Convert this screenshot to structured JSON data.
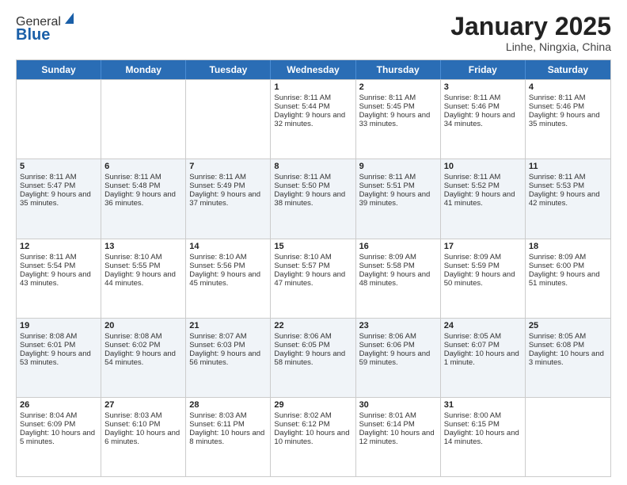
{
  "header": {
    "logo_general": "General",
    "logo_blue": "Blue",
    "month_title": "January 2025",
    "location": "Linhe, Ningxia, China"
  },
  "weekdays": [
    "Sunday",
    "Monday",
    "Tuesday",
    "Wednesday",
    "Thursday",
    "Friday",
    "Saturday"
  ],
  "weeks": [
    [
      {
        "day": "",
        "sunrise": "",
        "sunset": "",
        "daylight": ""
      },
      {
        "day": "",
        "sunrise": "",
        "sunset": "",
        "daylight": ""
      },
      {
        "day": "",
        "sunrise": "",
        "sunset": "",
        "daylight": ""
      },
      {
        "day": "1",
        "sunrise": "Sunrise: 8:11 AM",
        "sunset": "Sunset: 5:44 PM",
        "daylight": "Daylight: 9 hours and 32 minutes."
      },
      {
        "day": "2",
        "sunrise": "Sunrise: 8:11 AM",
        "sunset": "Sunset: 5:45 PM",
        "daylight": "Daylight: 9 hours and 33 minutes."
      },
      {
        "day": "3",
        "sunrise": "Sunrise: 8:11 AM",
        "sunset": "Sunset: 5:46 PM",
        "daylight": "Daylight: 9 hours and 34 minutes."
      },
      {
        "day": "4",
        "sunrise": "Sunrise: 8:11 AM",
        "sunset": "Sunset: 5:46 PM",
        "daylight": "Daylight: 9 hours and 35 minutes."
      }
    ],
    [
      {
        "day": "5",
        "sunrise": "Sunrise: 8:11 AM",
        "sunset": "Sunset: 5:47 PM",
        "daylight": "Daylight: 9 hours and 35 minutes."
      },
      {
        "day": "6",
        "sunrise": "Sunrise: 8:11 AM",
        "sunset": "Sunset: 5:48 PM",
        "daylight": "Daylight: 9 hours and 36 minutes."
      },
      {
        "day": "7",
        "sunrise": "Sunrise: 8:11 AM",
        "sunset": "Sunset: 5:49 PM",
        "daylight": "Daylight: 9 hours and 37 minutes."
      },
      {
        "day": "8",
        "sunrise": "Sunrise: 8:11 AM",
        "sunset": "Sunset: 5:50 PM",
        "daylight": "Daylight: 9 hours and 38 minutes."
      },
      {
        "day": "9",
        "sunrise": "Sunrise: 8:11 AM",
        "sunset": "Sunset: 5:51 PM",
        "daylight": "Daylight: 9 hours and 39 minutes."
      },
      {
        "day": "10",
        "sunrise": "Sunrise: 8:11 AM",
        "sunset": "Sunset: 5:52 PM",
        "daylight": "Daylight: 9 hours and 41 minutes."
      },
      {
        "day": "11",
        "sunrise": "Sunrise: 8:11 AM",
        "sunset": "Sunset: 5:53 PM",
        "daylight": "Daylight: 9 hours and 42 minutes."
      }
    ],
    [
      {
        "day": "12",
        "sunrise": "Sunrise: 8:11 AM",
        "sunset": "Sunset: 5:54 PM",
        "daylight": "Daylight: 9 hours and 43 minutes."
      },
      {
        "day": "13",
        "sunrise": "Sunrise: 8:10 AM",
        "sunset": "Sunset: 5:55 PM",
        "daylight": "Daylight: 9 hours and 44 minutes."
      },
      {
        "day": "14",
        "sunrise": "Sunrise: 8:10 AM",
        "sunset": "Sunset: 5:56 PM",
        "daylight": "Daylight: 9 hours and 45 minutes."
      },
      {
        "day": "15",
        "sunrise": "Sunrise: 8:10 AM",
        "sunset": "Sunset: 5:57 PM",
        "daylight": "Daylight: 9 hours and 47 minutes."
      },
      {
        "day": "16",
        "sunrise": "Sunrise: 8:09 AM",
        "sunset": "Sunset: 5:58 PM",
        "daylight": "Daylight: 9 hours and 48 minutes."
      },
      {
        "day": "17",
        "sunrise": "Sunrise: 8:09 AM",
        "sunset": "Sunset: 5:59 PM",
        "daylight": "Daylight: 9 hours and 50 minutes."
      },
      {
        "day": "18",
        "sunrise": "Sunrise: 8:09 AM",
        "sunset": "Sunset: 6:00 PM",
        "daylight": "Daylight: 9 hours and 51 minutes."
      }
    ],
    [
      {
        "day": "19",
        "sunrise": "Sunrise: 8:08 AM",
        "sunset": "Sunset: 6:01 PM",
        "daylight": "Daylight: 9 hours and 53 minutes."
      },
      {
        "day": "20",
        "sunrise": "Sunrise: 8:08 AM",
        "sunset": "Sunset: 6:02 PM",
        "daylight": "Daylight: 9 hours and 54 minutes."
      },
      {
        "day": "21",
        "sunrise": "Sunrise: 8:07 AM",
        "sunset": "Sunset: 6:03 PM",
        "daylight": "Daylight: 9 hours and 56 minutes."
      },
      {
        "day": "22",
        "sunrise": "Sunrise: 8:06 AM",
        "sunset": "Sunset: 6:05 PM",
        "daylight": "Daylight: 9 hours and 58 minutes."
      },
      {
        "day": "23",
        "sunrise": "Sunrise: 8:06 AM",
        "sunset": "Sunset: 6:06 PM",
        "daylight": "Daylight: 9 hours and 59 minutes."
      },
      {
        "day": "24",
        "sunrise": "Sunrise: 8:05 AM",
        "sunset": "Sunset: 6:07 PM",
        "daylight": "Daylight: 10 hours and 1 minute."
      },
      {
        "day": "25",
        "sunrise": "Sunrise: 8:05 AM",
        "sunset": "Sunset: 6:08 PM",
        "daylight": "Daylight: 10 hours and 3 minutes."
      }
    ],
    [
      {
        "day": "26",
        "sunrise": "Sunrise: 8:04 AM",
        "sunset": "Sunset: 6:09 PM",
        "daylight": "Daylight: 10 hours and 5 minutes."
      },
      {
        "day": "27",
        "sunrise": "Sunrise: 8:03 AM",
        "sunset": "Sunset: 6:10 PM",
        "daylight": "Daylight: 10 hours and 6 minutes."
      },
      {
        "day": "28",
        "sunrise": "Sunrise: 8:03 AM",
        "sunset": "Sunset: 6:11 PM",
        "daylight": "Daylight: 10 hours and 8 minutes."
      },
      {
        "day": "29",
        "sunrise": "Sunrise: 8:02 AM",
        "sunset": "Sunset: 6:12 PM",
        "daylight": "Daylight: 10 hours and 10 minutes."
      },
      {
        "day": "30",
        "sunrise": "Sunrise: 8:01 AM",
        "sunset": "Sunset: 6:14 PM",
        "daylight": "Daylight: 10 hours and 12 minutes."
      },
      {
        "day": "31",
        "sunrise": "Sunrise: 8:00 AM",
        "sunset": "Sunset: 6:15 PM",
        "daylight": "Daylight: 10 hours and 14 minutes."
      },
      {
        "day": "",
        "sunrise": "",
        "sunset": "",
        "daylight": ""
      }
    ]
  ]
}
